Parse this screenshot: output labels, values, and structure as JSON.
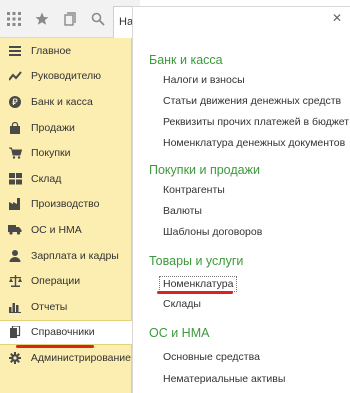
{
  "toolbar": {
    "home_tab_label": "Нач"
  },
  "sidebar": {
    "items": [
      {
        "label": "Главное",
        "icon": "list-icon"
      },
      {
        "label": "Руководителю",
        "icon": "trend-icon"
      },
      {
        "label": "Банк и касса",
        "icon": "ruble-coin-icon"
      },
      {
        "label": "Продажи",
        "icon": "bag-icon"
      },
      {
        "label": "Покупки",
        "icon": "cart-icon"
      },
      {
        "label": "Склад",
        "icon": "warehouse-icon"
      },
      {
        "label": "Производство",
        "icon": "factory-icon"
      },
      {
        "label": "ОС и НМА",
        "icon": "truck-icon"
      },
      {
        "label": "Зарплата и кадры",
        "icon": "person-icon"
      },
      {
        "label": "Операции",
        "icon": "scales-icon"
      },
      {
        "label": "Отчеты",
        "icon": "bar-chart-icon"
      },
      {
        "label": "Справочники",
        "icon": "book-icon"
      },
      {
        "label": "Администрирование",
        "icon": "gear-icon"
      }
    ],
    "active_label": "Справочники"
  },
  "panel": {
    "sections": [
      {
        "title": "Банк и касса",
        "links": [
          "Налоги и взносы",
          "Статьи движения денежных средств",
          "Реквизиты прочих платежей в бюджет",
          "Номенклатура денежных документов"
        ]
      },
      {
        "title": "Покупки и продажи",
        "links": [
          "Контрагенты",
          "Валюты",
          "Шаблоны договоров"
        ]
      },
      {
        "title": "Товары и услуги",
        "links": [
          "Номенклатура",
          "Склады"
        ]
      },
      {
        "title": "ОС и НМА",
        "links": [
          "Основные средства",
          "Нематериальные активы"
        ]
      }
    ]
  },
  "colors": {
    "sidebar_bg": "#fbeeb0",
    "section_title": "#3c9a3c",
    "highlight_underline": "#d9231c"
  }
}
